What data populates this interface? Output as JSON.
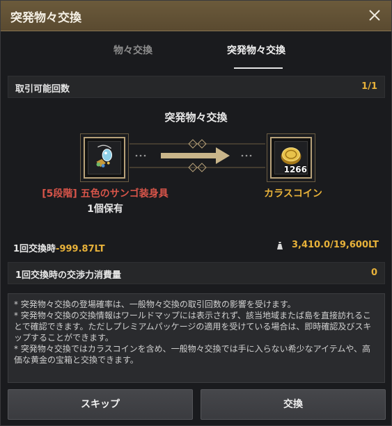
{
  "window": {
    "title": "突発物々交換"
  },
  "tabs": [
    {
      "label": "物々交換",
      "active": false
    },
    {
      "label": "突発物々交換",
      "active": true
    }
  ],
  "trade_count": {
    "label": "取引可能回数",
    "value": "1/1"
  },
  "exchange": {
    "title": "突発物々交換",
    "give_item": {
      "name": "[5段階] 五色のサンゴ装身具",
      "owned": "1個保有",
      "icon": "coral-necklace-icon"
    },
    "receive_item": {
      "name": "カラスコイン",
      "count": "1266",
      "icon": "crow-coin-icon"
    }
  },
  "per_trade": {
    "label": "1回交換時",
    "weight_change": "-999.87LT",
    "capacity": "3,410.0/19,600LT",
    "weight_icon": "weight-bag-icon"
  },
  "contribution": {
    "label": "1回交換時の交渉力消費量",
    "value": "0"
  },
  "notes": [
    "* 突発物々交換の登場確率は、一般物々交換の取引回数の影響を受けます。",
    "* 突発物々交換の交換情報はワールドマップには表示されず、該当地域またば島を直接訪れることで確認できます。ただしプレミアムパッケージの適用を受けている場合は、即時確認及びスキップすることができます。",
    "* 突発物々交換ではカラスコインを含め、一般物々交換では手に入らない希少なアイテムや、高価な黄金の宝箱と交換できます。"
  ],
  "buttons": {
    "skip": "スキップ",
    "exchange": "交換"
  },
  "colors": {
    "accent": "#e8b23a",
    "danger": "#d8554a",
    "titlebar": "#6b5a3b"
  }
}
